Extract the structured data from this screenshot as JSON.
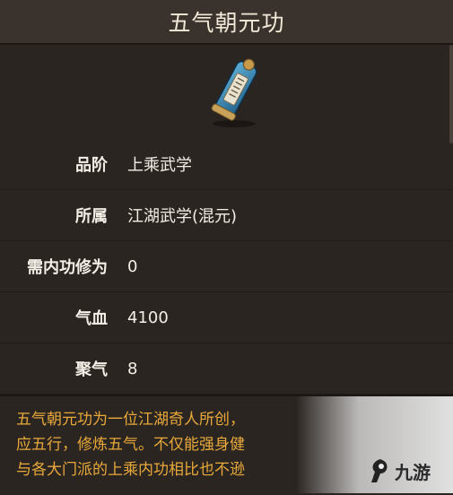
{
  "window": {
    "title": "五气朝元功"
  },
  "item": {
    "icon": "scroll-icon"
  },
  "attributes": [
    {
      "label": "品阶",
      "value": "上乘武学"
    },
    {
      "label": "所属",
      "value": "江湖武学(混元)"
    },
    {
      "label": "需内功修为",
      "value": "0"
    },
    {
      "label": "气血",
      "value": "4100"
    },
    {
      "label": "聚气",
      "value": "8"
    }
  ],
  "description": {
    "lines": [
      "五气朝元功为一位江湖奇人所创，",
      "应五行，修炼五气。不仅能强身健",
      "与各大门派的上乘内功相比也不逊"
    ]
  },
  "watermark": {
    "text": "九游"
  },
  "colors": {
    "accent": "#e9a93a",
    "text": "#f4efe6",
    "background": "#2b2521"
  }
}
